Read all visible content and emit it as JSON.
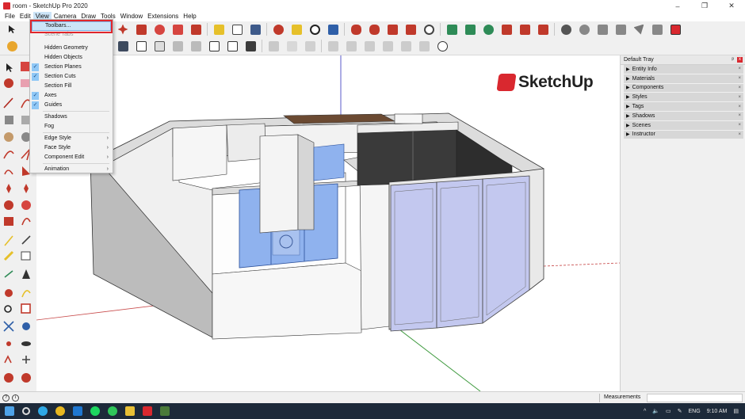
{
  "window": {
    "title": "room - SketchUp Pro 2020",
    "controls": {
      "minimize": "–",
      "maximize": "❐",
      "close": "✕"
    }
  },
  "menubar": {
    "items": [
      {
        "label": "File",
        "id": "file"
      },
      {
        "label": "Edit",
        "id": "edit"
      },
      {
        "label": "View",
        "id": "view",
        "active": true
      },
      {
        "label": "Camera",
        "id": "camera"
      },
      {
        "label": "Draw",
        "id": "draw"
      },
      {
        "label": "Tools",
        "id": "tools"
      },
      {
        "label": "Window",
        "id": "window"
      },
      {
        "label": "Extensions",
        "id": "extensions"
      },
      {
        "label": "Help",
        "id": "help"
      }
    ]
  },
  "view_menu": {
    "items": [
      {
        "label": "Toolbars...",
        "highlighted": true
      },
      {
        "label": "Scene Tabs",
        "disabled": true
      },
      {
        "label": "Hidden Geometry",
        "checked": false
      },
      {
        "label": "Hidden Objects",
        "checked": false
      },
      {
        "label": "Section Planes",
        "checked": true
      },
      {
        "label": "Section Cuts",
        "checked": true
      },
      {
        "label": "Section Fill",
        "checked": false
      },
      {
        "label": "Axes",
        "checked": true
      },
      {
        "label": "Guides",
        "checked": true
      },
      {
        "label": "Shadows",
        "checked": false
      },
      {
        "label": "Fog",
        "checked": false
      },
      {
        "label": "Edge Style",
        "submenu": true
      },
      {
        "label": "Face Style",
        "submenu": true
      },
      {
        "label": "Component Edit",
        "submenu": true
      },
      {
        "label": "Animation",
        "submenu": true
      }
    ]
  },
  "viewport": {
    "logo_text": "SketchUp"
  },
  "tray": {
    "title": "Default Tray",
    "pin": "ᵖ",
    "close": "x",
    "panels": [
      {
        "label": "Entity Info"
      },
      {
        "label": "Materials"
      },
      {
        "label": "Components"
      },
      {
        "label": "Styles"
      },
      {
        "label": "Tags"
      },
      {
        "label": "Shadows"
      },
      {
        "label": "Scenes"
      },
      {
        "label": "Instructor"
      }
    ]
  },
  "statusbar": {
    "measurements_label": "Measurements",
    "measurements_value": ""
  },
  "taskbar": {
    "clock": "9:10 AM",
    "language": "ENG"
  },
  "colors": {
    "accent_red": "#e0262c",
    "menu_highlight": "#cce4f7",
    "glass_blue": "#8fb2ee",
    "glass_lavender": "#c3c8ef",
    "wall_white": "#f4f4f4",
    "floor_brown": "#6b4a32"
  }
}
